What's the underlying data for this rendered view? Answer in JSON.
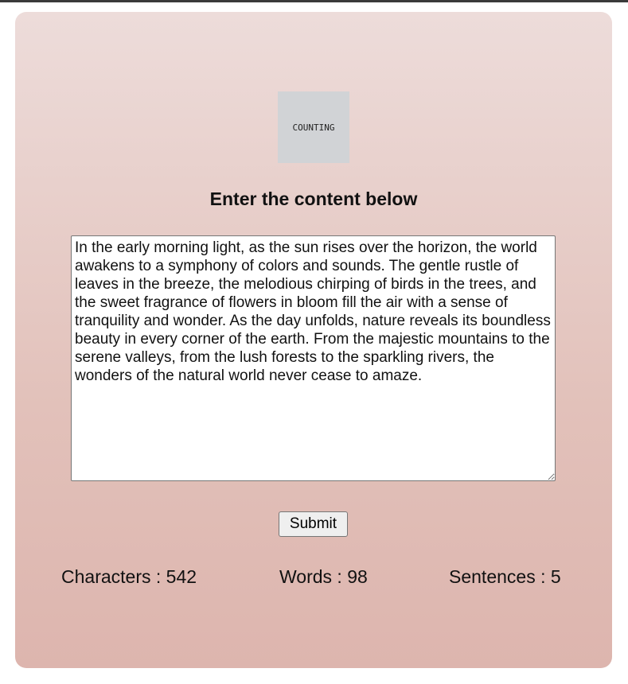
{
  "logo": {
    "text": "COUNTING"
  },
  "form": {
    "heading": "Enter the content below",
    "content": "In the early morning light, as the sun rises over the horizon, the world awakens to a symphony of colors and sounds. The gentle rustle of leaves in the breeze, the melodious chirping of birds in the trees, and the sweet fragrance of flowers in bloom fill the air with a sense of tranquility and wonder. As the day unfolds, nature reveals its boundless beauty in every corner of the earth. From the majestic mountains to the serene valleys, from the lush forests to the sparkling rivers, the wonders of the natural world never cease to amaze.",
    "submit_label": "Submit"
  },
  "stats": {
    "characters": "Characters : 542",
    "words": "Words : 98",
    "sentences": "Sentences : 5"
  },
  "colors": {
    "card_top": "#eddcda",
    "card_bottom": "#ddb5ae",
    "logo_bg": "#d1d3d6"
  }
}
